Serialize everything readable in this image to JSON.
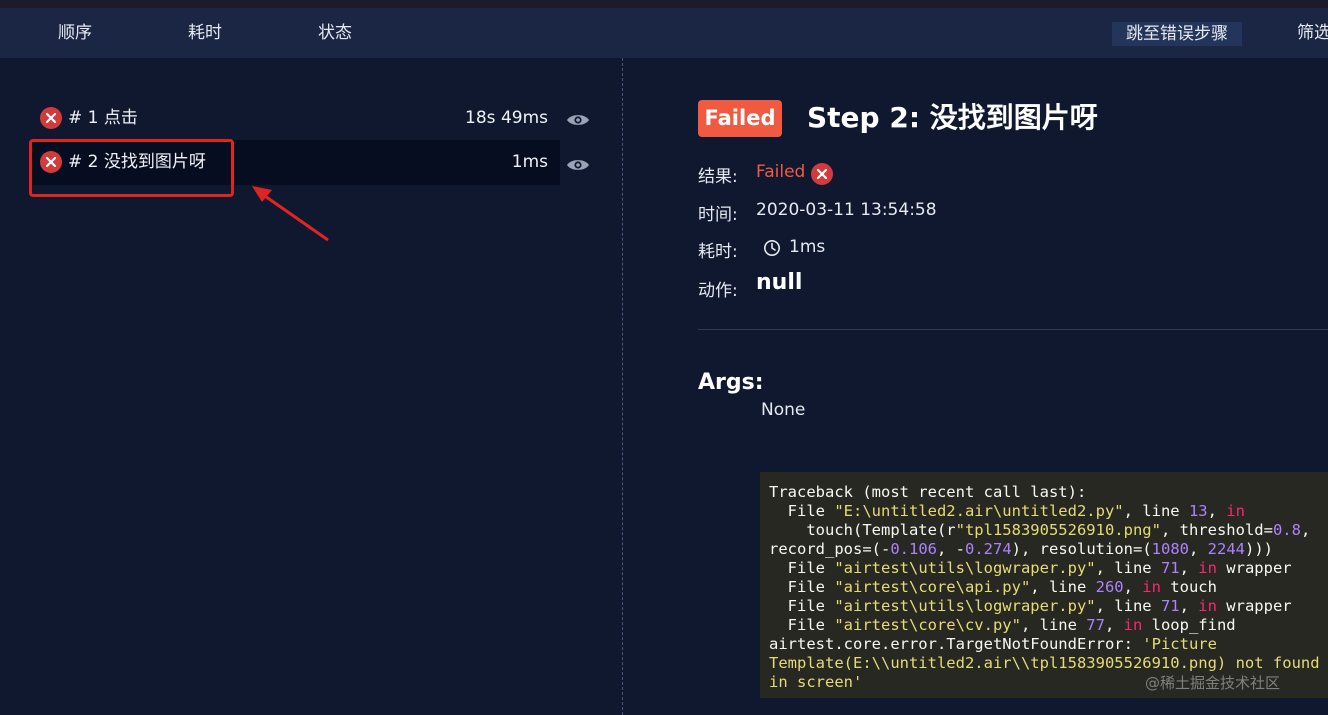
{
  "header": {
    "columns": [
      "顺序",
      "耗时",
      "状态"
    ],
    "jump_button": "跳至错误步骤",
    "filter_button": "筛选"
  },
  "steps": [
    {
      "title": "# 1 点击",
      "time": "18s 49ms",
      "status": "failed"
    },
    {
      "title": "# 2 没找到图片呀",
      "time": "1ms",
      "status": "failed",
      "selected": true
    }
  ],
  "detail": {
    "badge": "Failed",
    "title": "Step 2: 没找到图片呀",
    "result_label": "结果:",
    "result_value": "Failed",
    "time_label": "时间:",
    "time_value": "2020-03-11 13:54:58",
    "duration_label": "耗时:",
    "duration_value": "1ms",
    "action_label": "动作:",
    "action_value": "null",
    "args_title": "Args:",
    "args_value": "None"
  },
  "traceback": [
    [
      [
        "t",
        "Traceback (most recent call last):"
      ]
    ],
    [
      [
        "t",
        "  File "
      ],
      [
        "s",
        "\"E:\\untitled2.air\\untitled2.py\""
      ],
      [
        "t",
        ", line "
      ],
      [
        "n",
        "13"
      ],
      [
        "t",
        ", "
      ],
      [
        "k",
        "in"
      ]
    ],
    [
      [
        "t",
        "    touch(Template(r"
      ],
      [
        "s",
        "\"tpl1583905526910.png\""
      ],
      [
        "t",
        ", threshold="
      ],
      [
        "n",
        "0.8"
      ],
      [
        "t",
        ","
      ]
    ],
    [
      [
        "t",
        "record_pos=(-"
      ],
      [
        "n",
        "0.106"
      ],
      [
        "t",
        ", -"
      ],
      [
        "n",
        "0.274"
      ],
      [
        "t",
        "), resolution=("
      ],
      [
        "n",
        "1080"
      ],
      [
        "t",
        ", "
      ],
      [
        "n",
        "2244"
      ],
      [
        "t",
        ")))"
      ]
    ],
    [
      [
        "t",
        "  File "
      ],
      [
        "s",
        "\"airtest\\utils\\logwraper.py\""
      ],
      [
        "t",
        ", line "
      ],
      [
        "n",
        "71"
      ],
      [
        "t",
        ", "
      ],
      [
        "k",
        "in"
      ],
      [
        "t",
        " wrapper"
      ]
    ],
    [
      [
        "t",
        "  File "
      ],
      [
        "s",
        "\"airtest\\core\\api.py\""
      ],
      [
        "t",
        ", line "
      ],
      [
        "n",
        "260"
      ],
      [
        "t",
        ", "
      ],
      [
        "k",
        "in"
      ],
      [
        "t",
        " touch"
      ]
    ],
    [
      [
        "t",
        "  File "
      ],
      [
        "s",
        "\"airtest\\utils\\logwraper.py\""
      ],
      [
        "t",
        ", line "
      ],
      [
        "n",
        "71"
      ],
      [
        "t",
        ", "
      ],
      [
        "k",
        "in"
      ],
      [
        "t",
        " wrapper"
      ]
    ],
    [
      [
        "t",
        "  File "
      ],
      [
        "s",
        "\"airtest\\core\\cv.py\""
      ],
      [
        "t",
        ", line "
      ],
      [
        "n",
        "77"
      ],
      [
        "t",
        ", "
      ],
      [
        "k",
        "in"
      ],
      [
        "t",
        " loop_find"
      ]
    ],
    [
      [
        "t",
        "airtest.core.error.TargetNotFoundError: "
      ],
      [
        "s",
        "'Picture"
      ]
    ],
    [
      [
        "s",
        "Template(E:\\\\untitled2.air\\\\tpl1583905526910.png) not found"
      ]
    ],
    [
      [
        "s",
        "in screen'"
      ]
    ]
  ],
  "watermark": "@稀土掘金技术社区",
  "colors": {
    "background": "#101830",
    "header": "#1a2644",
    "failed": "#f05a41",
    "error_icon": "#d23b3b",
    "highlight": "#e02424"
  }
}
